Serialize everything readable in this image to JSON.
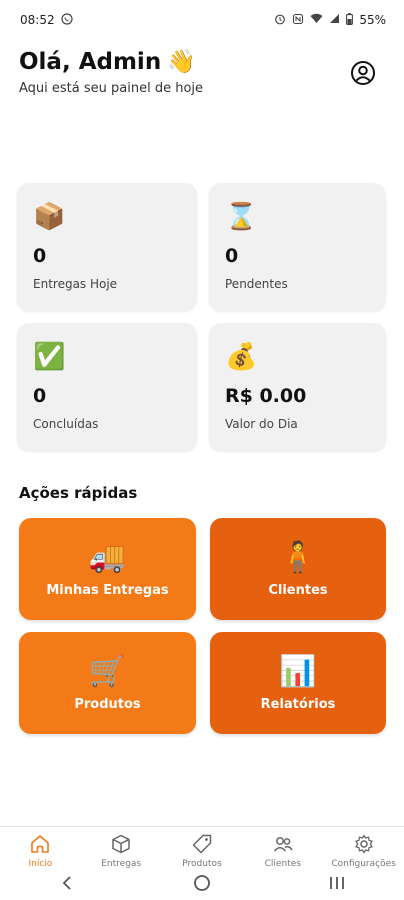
{
  "status_bar": {
    "time": "08:52",
    "battery": "55%"
  },
  "greeting": {
    "title": "Olá, Admin",
    "wave_emoji": "👋",
    "subtitle": "Aqui está seu painel de hoje"
  },
  "stats": [
    {
      "emoji": "📦",
      "value": "0",
      "label": "Entregas Hoje"
    },
    {
      "emoji": "⌛",
      "value": "0",
      "label": "Pendentes"
    },
    {
      "emoji": "✅",
      "value": "0",
      "label": "Concluídas"
    },
    {
      "emoji": "💰",
      "value": "R$ 0.00",
      "label": "Valor do Dia"
    }
  ],
  "quick_actions": {
    "title": "Ações rápidas",
    "items": [
      {
        "emoji": "🚚",
        "label": "Minhas Entregas"
      },
      {
        "emoji": "🧍",
        "label": "Clientes"
      },
      {
        "emoji": "🛒",
        "label": "Produtos"
      },
      {
        "emoji": "📊",
        "label": "Relatórios"
      }
    ]
  },
  "bottom_nav": [
    {
      "label": "Início",
      "icon": "home-icon",
      "active": true
    },
    {
      "label": "Entregas",
      "icon": "box-icon",
      "active": false
    },
    {
      "label": "Produtos",
      "icon": "tag-icon",
      "active": false
    },
    {
      "label": "Clientes",
      "icon": "people-icon",
      "active": false
    },
    {
      "label": "Configurações",
      "icon": "gear-icon",
      "active": false
    }
  ],
  "colors": {
    "accent": "#f47a17",
    "accent_dark": "#e6610f",
    "card_bg": "#f1f1f1"
  }
}
